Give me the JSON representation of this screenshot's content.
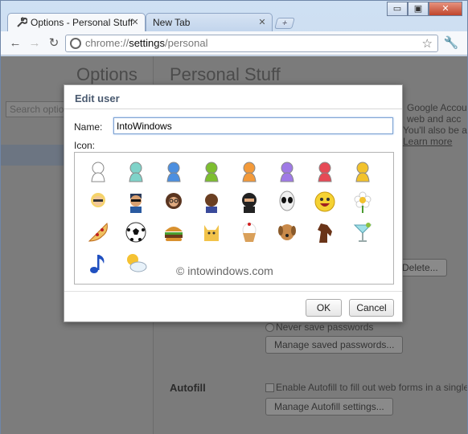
{
  "browser": {
    "tabs": [
      {
        "label": "Options - Personal Stuff"
      },
      {
        "label": "New Tab"
      }
    ],
    "window_buttons": {
      "minimize": "▭",
      "restore": "▣",
      "close": "✕"
    },
    "omnibox": {
      "scheme": "chrome://",
      "host": "settings",
      "path": "/personal"
    }
  },
  "sidebar": {
    "title": "Options",
    "search_placeholder": "Search optio"
  },
  "page": {
    "title": "Personal Stuff",
    "sync_text": [
      "Google Accou",
      "web and acc",
      "You'll also be a",
      "Learn more"
    ],
    "delete_button": "Delete...",
    "never_save": "Never save passwords",
    "manage_passwords": "Manage saved passwords...",
    "autofill_heading": "Autofill",
    "autofill_checkbox": "Enable Autofill to fill out web forms in a single c",
    "manage_autofill": "Manage Autofill settings..."
  },
  "dialog": {
    "title": "Edit user",
    "name_label": "Name:",
    "name_value": "IntoWindows",
    "icon_label": "Icon:",
    "ok": "OK",
    "cancel": "Cancel",
    "icons": [
      "white-person-icon",
      "teal-person-icon",
      "blue-person-icon",
      "green-person-icon",
      "orange-person-icon",
      "purple-person-icon",
      "red-person-icon",
      "yellow-person-icon",
      "blonde-woman-icon",
      "sunglasses-man-icon",
      "woman-glasses-icon",
      "bald-man-icon",
      "ninja-icon",
      "alien-icon",
      "smiley-icon",
      "flower-icon",
      "pizza-icon",
      "soccer-ball-icon",
      "burger-icon",
      "cat-icon",
      "cupcake-icon",
      "dog-icon",
      "horse-icon",
      "cocktail-icon",
      "music-note-icon",
      "sun-cloud-icon"
    ]
  },
  "watermark": "© intowindows.com",
  "colors": {
    "person": [
      "#ffffff",
      "#7fd3c9",
      "#4c8fe0",
      "#7dbe2f",
      "#f39a3a",
      "#9f7ae6",
      "#e64a56",
      "#f2c22c"
    ]
  }
}
